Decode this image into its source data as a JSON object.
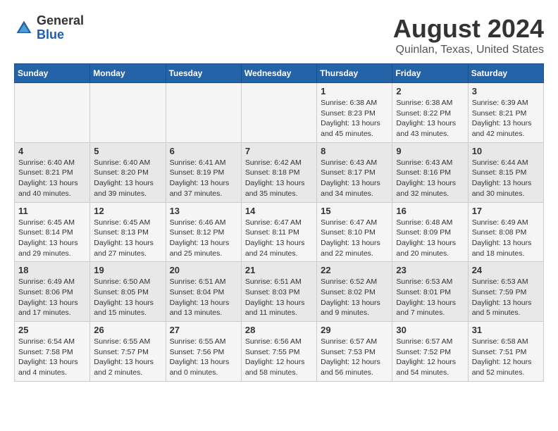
{
  "logo": {
    "general": "General",
    "blue": "Blue"
  },
  "title": "August 2024",
  "subtitle": "Quinlan, Texas, United States",
  "days_of_week": [
    "Sunday",
    "Monday",
    "Tuesday",
    "Wednesday",
    "Thursday",
    "Friday",
    "Saturday"
  ],
  "weeks": [
    [
      {
        "day": "",
        "text": ""
      },
      {
        "day": "",
        "text": ""
      },
      {
        "day": "",
        "text": ""
      },
      {
        "day": "",
        "text": ""
      },
      {
        "day": "1",
        "text": "Sunrise: 6:38 AM\nSunset: 8:23 PM\nDaylight: 13 hours\nand 45 minutes."
      },
      {
        "day": "2",
        "text": "Sunrise: 6:38 AM\nSunset: 8:22 PM\nDaylight: 13 hours\nand 43 minutes."
      },
      {
        "day": "3",
        "text": "Sunrise: 6:39 AM\nSunset: 8:21 PM\nDaylight: 13 hours\nand 42 minutes."
      }
    ],
    [
      {
        "day": "4",
        "text": "Sunrise: 6:40 AM\nSunset: 8:21 PM\nDaylight: 13 hours\nand 40 minutes."
      },
      {
        "day": "5",
        "text": "Sunrise: 6:40 AM\nSunset: 8:20 PM\nDaylight: 13 hours\nand 39 minutes."
      },
      {
        "day": "6",
        "text": "Sunrise: 6:41 AM\nSunset: 8:19 PM\nDaylight: 13 hours\nand 37 minutes."
      },
      {
        "day": "7",
        "text": "Sunrise: 6:42 AM\nSunset: 8:18 PM\nDaylight: 13 hours\nand 35 minutes."
      },
      {
        "day": "8",
        "text": "Sunrise: 6:43 AM\nSunset: 8:17 PM\nDaylight: 13 hours\nand 34 minutes."
      },
      {
        "day": "9",
        "text": "Sunrise: 6:43 AM\nSunset: 8:16 PM\nDaylight: 13 hours\nand 32 minutes."
      },
      {
        "day": "10",
        "text": "Sunrise: 6:44 AM\nSunset: 8:15 PM\nDaylight: 13 hours\nand 30 minutes."
      }
    ],
    [
      {
        "day": "11",
        "text": "Sunrise: 6:45 AM\nSunset: 8:14 PM\nDaylight: 13 hours\nand 29 minutes."
      },
      {
        "day": "12",
        "text": "Sunrise: 6:45 AM\nSunset: 8:13 PM\nDaylight: 13 hours\nand 27 minutes."
      },
      {
        "day": "13",
        "text": "Sunrise: 6:46 AM\nSunset: 8:12 PM\nDaylight: 13 hours\nand 25 minutes."
      },
      {
        "day": "14",
        "text": "Sunrise: 6:47 AM\nSunset: 8:11 PM\nDaylight: 13 hours\nand 24 minutes."
      },
      {
        "day": "15",
        "text": "Sunrise: 6:47 AM\nSunset: 8:10 PM\nDaylight: 13 hours\nand 22 minutes."
      },
      {
        "day": "16",
        "text": "Sunrise: 6:48 AM\nSunset: 8:09 PM\nDaylight: 13 hours\nand 20 minutes."
      },
      {
        "day": "17",
        "text": "Sunrise: 6:49 AM\nSunset: 8:08 PM\nDaylight: 13 hours\nand 18 minutes."
      }
    ],
    [
      {
        "day": "18",
        "text": "Sunrise: 6:49 AM\nSunset: 8:06 PM\nDaylight: 13 hours\nand 17 minutes."
      },
      {
        "day": "19",
        "text": "Sunrise: 6:50 AM\nSunset: 8:05 PM\nDaylight: 13 hours\nand 15 minutes."
      },
      {
        "day": "20",
        "text": "Sunrise: 6:51 AM\nSunset: 8:04 PM\nDaylight: 13 hours\nand 13 minutes."
      },
      {
        "day": "21",
        "text": "Sunrise: 6:51 AM\nSunset: 8:03 PM\nDaylight: 13 hours\nand 11 minutes."
      },
      {
        "day": "22",
        "text": "Sunrise: 6:52 AM\nSunset: 8:02 PM\nDaylight: 13 hours\nand 9 minutes."
      },
      {
        "day": "23",
        "text": "Sunrise: 6:53 AM\nSunset: 8:01 PM\nDaylight: 13 hours\nand 7 minutes."
      },
      {
        "day": "24",
        "text": "Sunrise: 6:53 AM\nSunset: 7:59 PM\nDaylight: 13 hours\nand 5 minutes."
      }
    ],
    [
      {
        "day": "25",
        "text": "Sunrise: 6:54 AM\nSunset: 7:58 PM\nDaylight: 13 hours\nand 4 minutes."
      },
      {
        "day": "26",
        "text": "Sunrise: 6:55 AM\nSunset: 7:57 PM\nDaylight: 13 hours\nand 2 minutes."
      },
      {
        "day": "27",
        "text": "Sunrise: 6:55 AM\nSunset: 7:56 PM\nDaylight: 13 hours\nand 0 minutes."
      },
      {
        "day": "28",
        "text": "Sunrise: 6:56 AM\nSunset: 7:55 PM\nDaylight: 12 hours\nand 58 minutes."
      },
      {
        "day": "29",
        "text": "Sunrise: 6:57 AM\nSunset: 7:53 PM\nDaylight: 12 hours\nand 56 minutes."
      },
      {
        "day": "30",
        "text": "Sunrise: 6:57 AM\nSunset: 7:52 PM\nDaylight: 12 hours\nand 54 minutes."
      },
      {
        "day": "31",
        "text": "Sunrise: 6:58 AM\nSunset: 7:51 PM\nDaylight: 12 hours\nand 52 minutes."
      }
    ]
  ]
}
